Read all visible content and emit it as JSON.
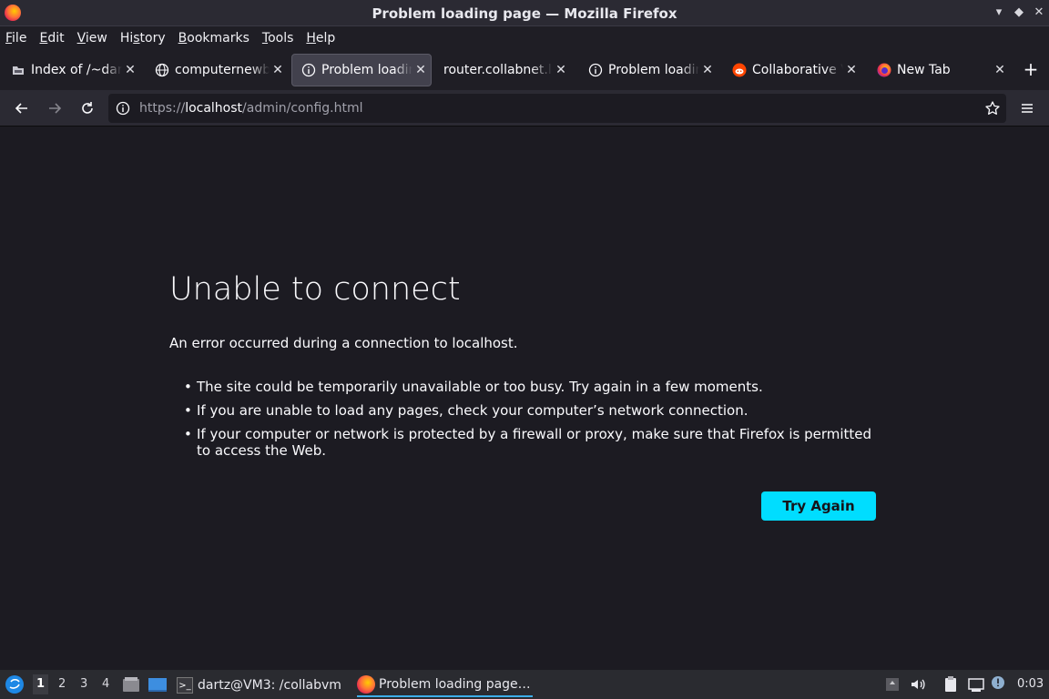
{
  "window": {
    "title": "Problem loading page — Mozilla Firefox"
  },
  "menu": [
    {
      "label": "File",
      "accel": "F",
      "rest": "ile"
    },
    {
      "label": "Edit",
      "accel": "E",
      "rest": "dit"
    },
    {
      "label": "View",
      "accel": "V",
      "rest": "iew"
    },
    {
      "label": "History",
      "pre": "Hi",
      "accel": "s",
      "rest": "tory"
    },
    {
      "label": "Bookmarks",
      "accel": "B",
      "rest": "ookmarks"
    },
    {
      "label": "Tools",
      "accel": "T",
      "rest": "ools"
    },
    {
      "label": "Help",
      "accel": "H",
      "rest": "elp"
    }
  ],
  "tabs": [
    {
      "label": "Index of /~dartz",
      "icon": "folder-icon",
      "active": false
    },
    {
      "label": "computernewb.com",
      "icon": "globe-icon",
      "active": false
    },
    {
      "label": "Problem loading page",
      "icon": "info-icon",
      "active": true
    },
    {
      "label": "router.collabnet.local",
      "icon": "none",
      "active": false
    },
    {
      "label": "Problem loading page",
      "icon": "info-icon",
      "active": false
    },
    {
      "label": "Collaborative Virtual Machine",
      "icon": "reddit-icon",
      "active": false
    },
    {
      "label": "New Tab",
      "icon": "firefox-icon",
      "active": false
    }
  ],
  "urlbar": {
    "scheme": "https://",
    "host": "localhost",
    "path": "/admin/config.html"
  },
  "error": {
    "title": "Unable to connect",
    "description": "An error occurred during a connection to localhost.",
    "items": [
      "The site could be temporarily unavailable or too busy. Try again in a few moments.",
      "If you are unable to load any pages, check your computer’s network connection.",
      "If your computer or network is protected by a firewall or proxy, make sure that Firefox is permitted to access the Web."
    ],
    "button": "Try Again"
  },
  "taskbar": {
    "workspaces": [
      "1",
      "2",
      "3",
      "4"
    ],
    "active_workspace": "1",
    "tasks": [
      {
        "label": "dartz@VM3: /collabvm",
        "icon": "terminal-icon"
      },
      {
        "label": "Problem loading page…",
        "icon": "firefox-icon"
      }
    ],
    "clock": "0:03"
  },
  "colors": {
    "accent": "#00ddff",
    "background": "#1c1b22",
    "toolbar": "#2b2a33"
  }
}
